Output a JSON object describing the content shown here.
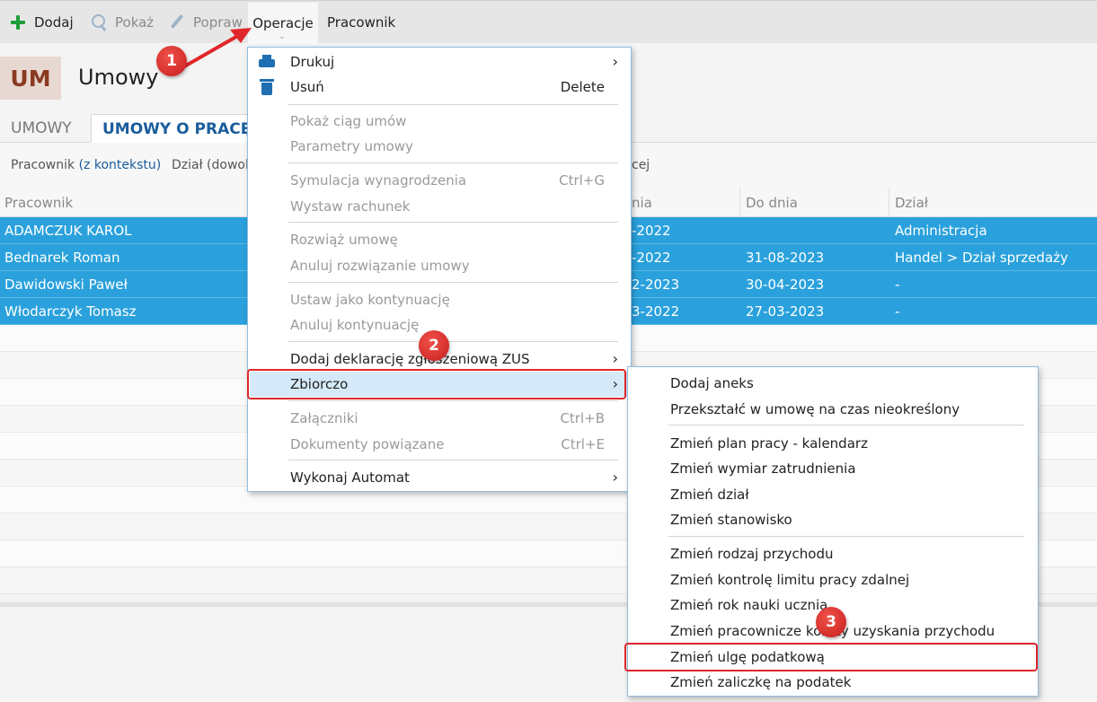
{
  "toolbar": {
    "dodaj": "Dodaj",
    "pokaz": "Pokaż",
    "popraw": "Popraw",
    "operacje": "Operacje",
    "pracownik": "Pracownik"
  },
  "header": {
    "badge": "UM",
    "title": "Umowy"
  },
  "tabs": [
    "UMOWY",
    "UMOWY O PRACĘ"
  ],
  "filters": {
    "pracownik_label": "Pracownik",
    "pracownik_link": "(z kontekstu)",
    "dzial_label": "Dział (dowol",
    "trailing": "cej"
  },
  "table": {
    "columns": {
      "pracownik": "Pracownik",
      "od_dnia": "nia",
      "do_dnia": "Do dnia",
      "dzial": "Dział"
    },
    "rows": [
      {
        "pracownik": "ADAMCZUK KAROL",
        "od": "-2022",
        "do": "",
        "dzial": "Administracja"
      },
      {
        "pracownik": "Bednarek Roman",
        "od": "-2022",
        "do": "31-08-2023",
        "dzial": "Handel > Dział sprzedaży"
      },
      {
        "pracownik": "Dawidowski Paweł",
        "od": "2-2023",
        "do": "30-04-2023",
        "dzial": "-"
      },
      {
        "pracownik": "Włodarczyk Tomasz",
        "od": "3-2022",
        "do": "27-03-2023",
        "dzial": "-"
      }
    ]
  },
  "menu_main": {
    "drukuj": "Drukuj",
    "usun": "Usuń",
    "usun_sc": "Delete",
    "pokaz_ciag": "Pokaż ciąg umów",
    "parametry": "Parametry umowy",
    "symulacja": "Symulacja wynagrodzenia",
    "symulacja_sc": "Ctrl+G",
    "wystaw": "Wystaw rachunek",
    "rozwiaz": "Rozwiąż umowę",
    "anuluj_rozw": "Anuluj rozwiązanie umowy",
    "ustaw_kont": "Ustaw jako kontynuację",
    "anuluj_kont": "Anuluj kontynuację",
    "dodaj_dekl": "Dodaj deklarację zgłoszeniową ZUS",
    "zbiorczo": "Zbiorczo",
    "zalaczniki": "Załączniki",
    "zalaczniki_sc": "Ctrl+B",
    "dokumenty": "Dokumenty powiązane",
    "dokumenty_sc": "Ctrl+E",
    "wykonaj": "Wykonaj Automat"
  },
  "menu_sub": {
    "dodaj_aneks": "Dodaj aneks",
    "przeksztalc": "Przekształć w umowę na czas nieokreślony",
    "plan_pracy": "Zmień plan pracy - kalendarz",
    "wymiar": "Zmień wymiar zatrudnienia",
    "dzial": "Zmień dział",
    "stanowisko": "Zmień stanowisko",
    "rodzaj": "Zmień rodzaj przychodu",
    "kontrole": "Zmień kontrolę limitu pracy zdalnej",
    "rok_nauki": "Zmień rok nauki ucznia",
    "koszty": "Zmień pracownicze koszty uzyskania przychodu",
    "ulge": "Zmień ulgę podatkową",
    "zaliczke": "Zmień zaliczkę na podatek"
  },
  "annotations": [
    "1",
    "2",
    "3"
  ],
  "colors": {
    "selected_row": "#2aa1dc",
    "accent": "#1a5d9c",
    "annotation_red": "#e0262a"
  }
}
